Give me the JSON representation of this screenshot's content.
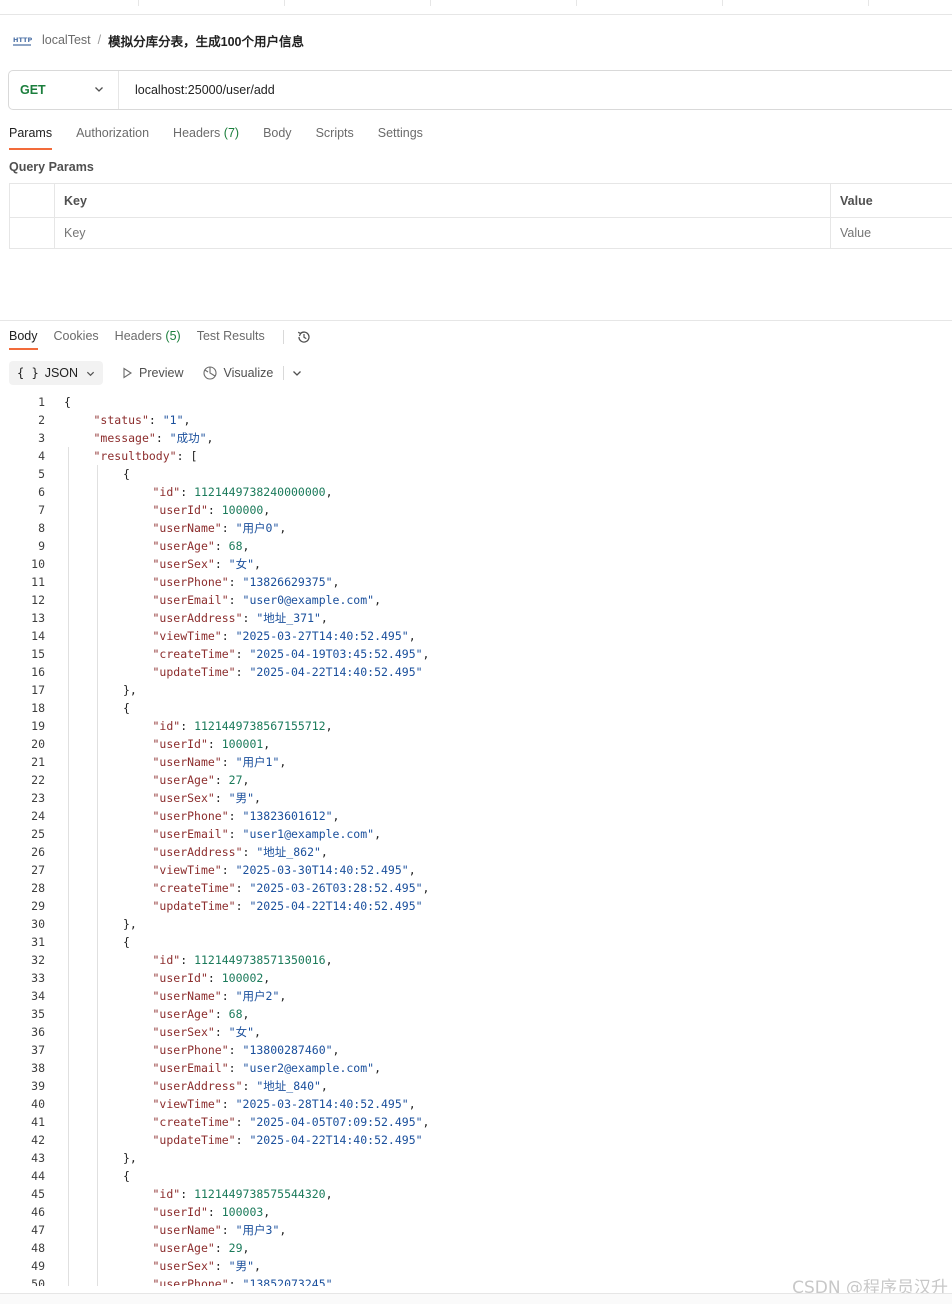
{
  "breadcrumb": {
    "parent": "localTest",
    "separator": "/",
    "current": "模拟分库分表，生成100个用户信息"
  },
  "request": {
    "method": "GET",
    "url": "localhost:25000/user/add"
  },
  "request_tabs": [
    {
      "label": "Params",
      "count": ""
    },
    {
      "label": "Authorization",
      "count": ""
    },
    {
      "label": "Headers",
      "count": "(7)"
    },
    {
      "label": "Body",
      "count": ""
    },
    {
      "label": "Scripts",
      "count": ""
    },
    {
      "label": "Settings",
      "count": ""
    }
  ],
  "query_params": {
    "title": "Query Params",
    "key_header": "Key",
    "value_header": "Value",
    "key_placeholder": "Key",
    "value_placeholder": "Value"
  },
  "response_tabs": [
    {
      "label": "Body",
      "count": ""
    },
    {
      "label": "Cookies",
      "count": ""
    },
    {
      "label": "Headers",
      "count": "(5)"
    },
    {
      "label": "Test Results",
      "count": ""
    }
  ],
  "format_bar": {
    "json_label": "JSON",
    "preview_label": "Preview",
    "visualize_label": "Visualize"
  },
  "code_lines": [
    [
      0,
      [
        [
          "p",
          "{"
        ]
      ]
    ],
    [
      1,
      [
        [
          "k",
          "\"status\""
        ],
        [
          "p",
          ": "
        ],
        [
          "s",
          "\"1\""
        ],
        [
          "p",
          ","
        ]
      ]
    ],
    [
      1,
      [
        [
          "k",
          "\"message\""
        ],
        [
          "p",
          ": "
        ],
        [
          "s",
          "\"成功\""
        ],
        [
          "p",
          ","
        ]
      ]
    ],
    [
      1,
      [
        [
          "k",
          "\"resultbody\""
        ],
        [
          "p",
          ": ["
        ]
      ]
    ],
    [
      2,
      [
        [
          "p",
          "{"
        ]
      ]
    ],
    [
      3,
      [
        [
          "k",
          "\"id\""
        ],
        [
          "p",
          ": "
        ],
        [
          "n",
          "1121449738240000000"
        ],
        [
          "p",
          ","
        ]
      ]
    ],
    [
      3,
      [
        [
          "k",
          "\"userId\""
        ],
        [
          "p",
          ": "
        ],
        [
          "n",
          "100000"
        ],
        [
          "p",
          ","
        ]
      ]
    ],
    [
      3,
      [
        [
          "k",
          "\"userName\""
        ],
        [
          "p",
          ": "
        ],
        [
          "s",
          "\"用户0\""
        ],
        [
          "p",
          ","
        ]
      ]
    ],
    [
      3,
      [
        [
          "k",
          "\"userAge\""
        ],
        [
          "p",
          ": "
        ],
        [
          "n",
          "68"
        ],
        [
          "p",
          ","
        ]
      ]
    ],
    [
      3,
      [
        [
          "k",
          "\"userSex\""
        ],
        [
          "p",
          ": "
        ],
        [
          "s",
          "\"女\""
        ],
        [
          "p",
          ","
        ]
      ]
    ],
    [
      3,
      [
        [
          "k",
          "\"userPhone\""
        ],
        [
          "p",
          ": "
        ],
        [
          "s",
          "\"13826629375\""
        ],
        [
          "p",
          ","
        ]
      ]
    ],
    [
      3,
      [
        [
          "k",
          "\"userEmail\""
        ],
        [
          "p",
          ": "
        ],
        [
          "s",
          "\"user0@example.com\""
        ],
        [
          "p",
          ","
        ]
      ]
    ],
    [
      3,
      [
        [
          "k",
          "\"userAddress\""
        ],
        [
          "p",
          ": "
        ],
        [
          "s",
          "\"地址_371\""
        ],
        [
          "p",
          ","
        ]
      ]
    ],
    [
      3,
      [
        [
          "k",
          "\"viewTime\""
        ],
        [
          "p",
          ": "
        ],
        [
          "s",
          "\"2025-03-27T14:40:52.495\""
        ],
        [
          "p",
          ","
        ]
      ]
    ],
    [
      3,
      [
        [
          "k",
          "\"createTime\""
        ],
        [
          "p",
          ": "
        ],
        [
          "s",
          "\"2025-04-19T03:45:52.495\""
        ],
        [
          "p",
          ","
        ]
      ]
    ],
    [
      3,
      [
        [
          "k",
          "\"updateTime\""
        ],
        [
          "p",
          ": "
        ],
        [
          "s",
          "\"2025-04-22T14:40:52.495\""
        ]
      ]
    ],
    [
      2,
      [
        [
          "p",
          "},"
        ]
      ]
    ],
    [
      2,
      [
        [
          "p",
          "{"
        ]
      ]
    ],
    [
      3,
      [
        [
          "k",
          "\"id\""
        ],
        [
          "p",
          ": "
        ],
        [
          "n",
          "1121449738567155712"
        ],
        [
          "p",
          ","
        ]
      ]
    ],
    [
      3,
      [
        [
          "k",
          "\"userId\""
        ],
        [
          "p",
          ": "
        ],
        [
          "n",
          "100001"
        ],
        [
          "p",
          ","
        ]
      ]
    ],
    [
      3,
      [
        [
          "k",
          "\"userName\""
        ],
        [
          "p",
          ": "
        ],
        [
          "s",
          "\"用户1\""
        ],
        [
          "p",
          ","
        ]
      ]
    ],
    [
      3,
      [
        [
          "k",
          "\"userAge\""
        ],
        [
          "p",
          ": "
        ],
        [
          "n",
          "27"
        ],
        [
          "p",
          ","
        ]
      ]
    ],
    [
      3,
      [
        [
          "k",
          "\"userSex\""
        ],
        [
          "p",
          ": "
        ],
        [
          "s",
          "\"男\""
        ],
        [
          "p",
          ","
        ]
      ]
    ],
    [
      3,
      [
        [
          "k",
          "\"userPhone\""
        ],
        [
          "p",
          ": "
        ],
        [
          "s",
          "\"13823601612\""
        ],
        [
          "p",
          ","
        ]
      ]
    ],
    [
      3,
      [
        [
          "k",
          "\"userEmail\""
        ],
        [
          "p",
          ": "
        ],
        [
          "s",
          "\"user1@example.com\""
        ],
        [
          "p",
          ","
        ]
      ]
    ],
    [
      3,
      [
        [
          "k",
          "\"userAddress\""
        ],
        [
          "p",
          ": "
        ],
        [
          "s",
          "\"地址_862\""
        ],
        [
          "p",
          ","
        ]
      ]
    ],
    [
      3,
      [
        [
          "k",
          "\"viewTime\""
        ],
        [
          "p",
          ": "
        ],
        [
          "s",
          "\"2025-03-30T14:40:52.495\""
        ],
        [
          "p",
          ","
        ]
      ]
    ],
    [
      3,
      [
        [
          "k",
          "\"createTime\""
        ],
        [
          "p",
          ": "
        ],
        [
          "s",
          "\"2025-03-26T03:28:52.495\""
        ],
        [
          "p",
          ","
        ]
      ]
    ],
    [
      3,
      [
        [
          "k",
          "\"updateTime\""
        ],
        [
          "p",
          ": "
        ],
        [
          "s",
          "\"2025-04-22T14:40:52.495\""
        ]
      ]
    ],
    [
      2,
      [
        [
          "p",
          "},"
        ]
      ]
    ],
    [
      2,
      [
        [
          "p",
          "{"
        ]
      ]
    ],
    [
      3,
      [
        [
          "k",
          "\"id\""
        ],
        [
          "p",
          ": "
        ],
        [
          "n",
          "1121449738571350016"
        ],
        [
          "p",
          ","
        ]
      ]
    ],
    [
      3,
      [
        [
          "k",
          "\"userId\""
        ],
        [
          "p",
          ": "
        ],
        [
          "n",
          "100002"
        ],
        [
          "p",
          ","
        ]
      ]
    ],
    [
      3,
      [
        [
          "k",
          "\"userName\""
        ],
        [
          "p",
          ": "
        ],
        [
          "s",
          "\"用户2\""
        ],
        [
          "p",
          ","
        ]
      ]
    ],
    [
      3,
      [
        [
          "k",
          "\"userAge\""
        ],
        [
          "p",
          ": "
        ],
        [
          "n",
          "68"
        ],
        [
          "p",
          ","
        ]
      ]
    ],
    [
      3,
      [
        [
          "k",
          "\"userSex\""
        ],
        [
          "p",
          ": "
        ],
        [
          "s",
          "\"女\""
        ],
        [
          "p",
          ","
        ]
      ]
    ],
    [
      3,
      [
        [
          "k",
          "\"userPhone\""
        ],
        [
          "p",
          ": "
        ],
        [
          "s",
          "\"13800287460\""
        ],
        [
          "p",
          ","
        ]
      ]
    ],
    [
      3,
      [
        [
          "k",
          "\"userEmail\""
        ],
        [
          "p",
          ": "
        ],
        [
          "s",
          "\"user2@example.com\""
        ],
        [
          "p",
          ","
        ]
      ]
    ],
    [
      3,
      [
        [
          "k",
          "\"userAddress\""
        ],
        [
          "p",
          ": "
        ],
        [
          "s",
          "\"地址_840\""
        ],
        [
          "p",
          ","
        ]
      ]
    ],
    [
      3,
      [
        [
          "k",
          "\"viewTime\""
        ],
        [
          "p",
          ": "
        ],
        [
          "s",
          "\"2025-03-28T14:40:52.495\""
        ],
        [
          "p",
          ","
        ]
      ]
    ],
    [
      3,
      [
        [
          "k",
          "\"createTime\""
        ],
        [
          "p",
          ": "
        ],
        [
          "s",
          "\"2025-04-05T07:09:52.495\""
        ],
        [
          "p",
          ","
        ]
      ]
    ],
    [
      3,
      [
        [
          "k",
          "\"updateTime\""
        ],
        [
          "p",
          ": "
        ],
        [
          "s",
          "\"2025-04-22T14:40:52.495\""
        ]
      ]
    ],
    [
      2,
      [
        [
          "p",
          "},"
        ]
      ]
    ],
    [
      2,
      [
        [
          "p",
          "{"
        ]
      ]
    ],
    [
      3,
      [
        [
          "k",
          "\"id\""
        ],
        [
          "p",
          ": "
        ],
        [
          "n",
          "1121449738575544320"
        ],
        [
          "p",
          ","
        ]
      ]
    ],
    [
      3,
      [
        [
          "k",
          "\"userId\""
        ],
        [
          "p",
          ": "
        ],
        [
          "n",
          "100003"
        ],
        [
          "p",
          ","
        ]
      ]
    ],
    [
      3,
      [
        [
          "k",
          "\"userName\""
        ],
        [
          "p",
          ": "
        ],
        [
          "s",
          "\"用户3\""
        ],
        [
          "p",
          ","
        ]
      ]
    ],
    [
      3,
      [
        [
          "k",
          "\"userAge\""
        ],
        [
          "p",
          ": "
        ],
        [
          "n",
          "29"
        ],
        [
          "p",
          ","
        ]
      ]
    ],
    [
      3,
      [
        [
          "k",
          "\"userSex\""
        ],
        [
          "p",
          ": "
        ],
        [
          "s",
          "\"男\""
        ],
        [
          "p",
          ","
        ]
      ]
    ],
    [
      3,
      [
        [
          "k",
          "\"userPhone\""
        ],
        [
          "p",
          ": "
        ],
        [
          "s",
          "\"13852073245\""
        ]
      ]
    ]
  ],
  "watermark": "CSDN @程序员汉升",
  "colors": {
    "accent": "#f26b3a",
    "method_get": "#1b7e3c",
    "json_key": "#8c2d2d",
    "json_string": "#1a4f9c",
    "json_number": "#1a7a5a"
  }
}
